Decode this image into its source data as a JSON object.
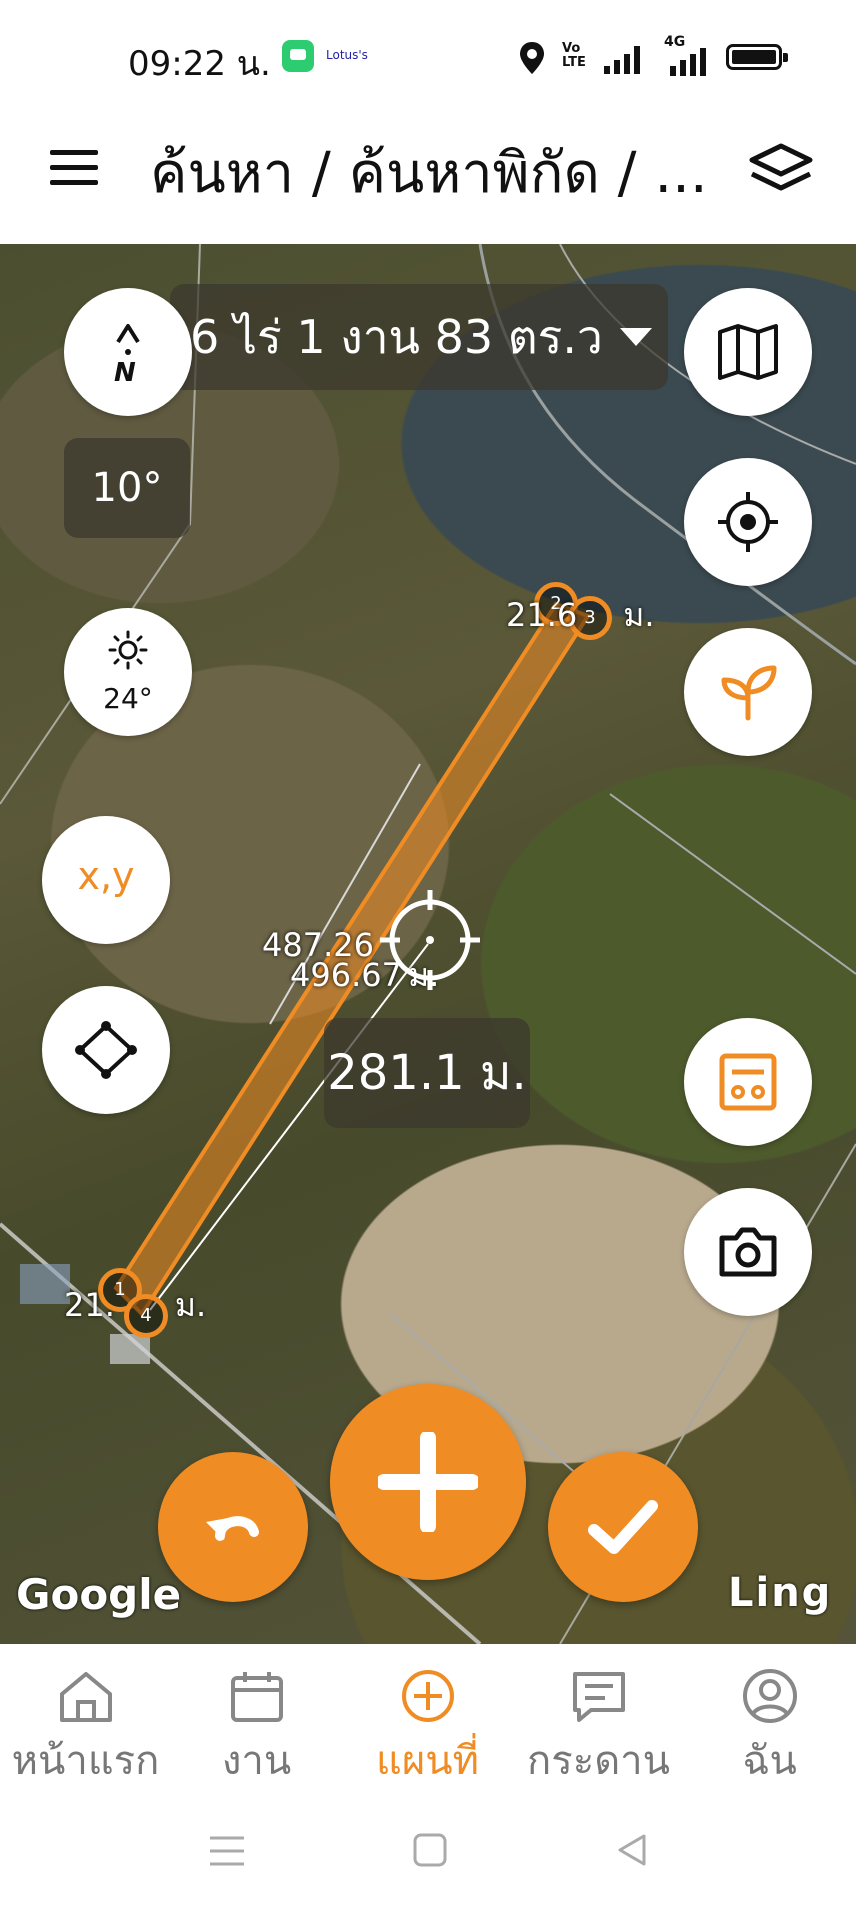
{
  "status_bar": {
    "time": "09:22 น.",
    "notification_app": "Lotus's",
    "network": "4G",
    "volte": "VoLTE2"
  },
  "app_bar": {
    "title": "ค้นหา / ค้นหาพิกัด / ...",
    "menu_icon": "hamburger-menu-icon",
    "layers_icon": "layers-icon"
  },
  "map": {
    "area_label": "6 ไร่ 1 งาน 83 ตร.ว",
    "compass_n": "N",
    "rotation": "10°",
    "temperature": "24°",
    "xy_label": "x,y",
    "center_distance": "281.1 ม.",
    "label_top_edge": "21.6",
    "label_top_edge_unit": "ม.",
    "label_bottom_edge": "21.",
    "label_bottom_edge_unit": "ม.",
    "label_length_a": "487.26",
    "label_length_b": "496.67",
    "label_length_unit": "ม.",
    "vertices": [
      "1",
      "2",
      "3",
      "4"
    ],
    "watermark_left": "Google",
    "watermark_right": "Ling",
    "accent_color": "#f08c24"
  },
  "bottom_nav": {
    "items": [
      {
        "label": "หน้าแรก",
        "icon": "home-icon",
        "active": false
      },
      {
        "label": "งาน",
        "icon": "calendar-icon",
        "active": false
      },
      {
        "label": "แผนที่",
        "icon": "add-circle-icon",
        "active": true
      },
      {
        "label": "กระดาน",
        "icon": "board-icon",
        "active": false
      },
      {
        "label": "ฉัน",
        "icon": "profile-icon",
        "active": false
      }
    ]
  }
}
